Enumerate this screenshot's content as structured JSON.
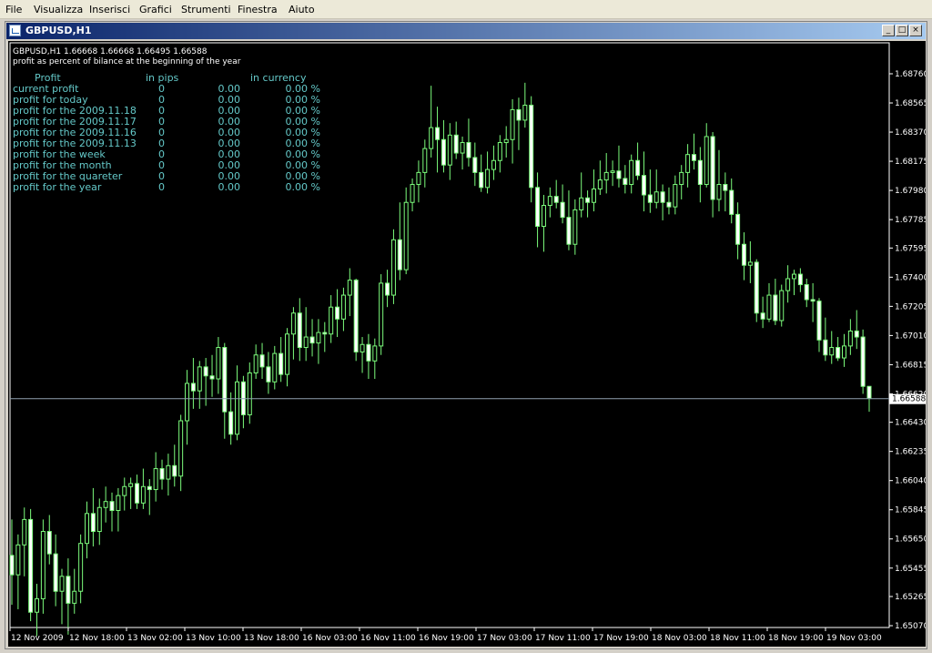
{
  "menu": [
    "File",
    "Visualizza",
    "Inserisci",
    "Grafici",
    "Strumenti",
    "Finestra",
    "Aiuto"
  ],
  "window": {
    "title": "GBPUSD,H1",
    "btn_min": "_",
    "btn_max": "□",
    "btn_close": "×"
  },
  "chart": {
    "header_line1": "GBPUSD,H1  1.66668 1.66668 1.66495 1.66588",
    "header_line2": "profit as percent of bilance at the beginning of the year",
    "profit_table": {
      "headers": [
        "Profit",
        "in pips",
        "in currency"
      ],
      "rows": [
        {
          "label": "current profit",
          "pips": "0",
          "currency": "0.00",
          "percent": "0.00 %"
        },
        {
          "label": "profit for today",
          "pips": "0",
          "currency": "0.00",
          "percent": "0.00 %"
        },
        {
          "label": "profit for the 2009.11.18",
          "pips": "0",
          "currency": "0.00",
          "percent": "0.00 %"
        },
        {
          "label": "profit for the 2009.11.17",
          "pips": "0",
          "currency": "0.00",
          "percent": "0.00 %"
        },
        {
          "label": "profit for the 2009.11.16",
          "pips": "0",
          "currency": "0.00",
          "percent": "0.00 %"
        },
        {
          "label": "profit for the 2009.11.13",
          "pips": "0",
          "currency": "0.00",
          "percent": "0.00 %"
        },
        {
          "label": "profit for the week",
          "pips": "0",
          "currency": "0.00",
          "percent": "0.00 %"
        },
        {
          "label": "profit for the month",
          "pips": "0",
          "currency": "0.00",
          "percent": "0.00 %"
        },
        {
          "label": "profit for the quareter",
          "pips": "0",
          "currency": "0.00",
          "percent": "0.00 %"
        },
        {
          "label": "profit for the year",
          "pips": "0",
          "currency": "0.00",
          "percent": "0.00 %"
        }
      ]
    },
    "current_price_label": "1.66588",
    "price_ticks": [
      "1.68760",
      "1.68565",
      "1.68370",
      "1.68175",
      "1.67980",
      "1.67785",
      "1.67595",
      "1.67400",
      "1.67205",
      "1.67010",
      "1.66815",
      "1.66620",
      "1.66430",
      "1.66235",
      "1.66040",
      "1.65845",
      "1.65650",
      "1.65455",
      "1.65265",
      "1.65070"
    ],
    "time_ticks": [
      "12 Nov 2009",
      "12 Nov 18:00",
      "13 Nov 02:00",
      "13 Nov 10:00",
      "13 Nov 18:00",
      "16 Nov 03:00",
      "16 Nov 11:00",
      "16 Nov 19:00",
      "17 Nov 03:00",
      "17 Nov 11:00",
      "17 Nov 19:00",
      "18 Nov 03:00",
      "18 Nov 11:00",
      "18 Nov 19:00",
      "19 Nov 03:00"
    ],
    "colors": {
      "background": "#000000",
      "candle": "#7cfc7c",
      "axis": "#ffffff",
      "profit_text": "#64c8c8",
      "price_line": "#8fa0b0"
    }
  },
  "chart_data": {
    "type": "candlestick",
    "symbol": "GBPUSD",
    "timeframe": "H1",
    "y_range": [
      1.6507,
      1.6876
    ],
    "current_price": 1.66588,
    "last_bar": {
      "open": 1.66668,
      "high": 1.66668,
      "low": 1.66495,
      "close": 1.66588
    },
    "candles": [
      [
        1.6554,
        1.6578,
        1.6521,
        1.6541
      ],
      [
        1.6541,
        1.6568,
        1.6518,
        1.6561
      ],
      [
        1.6561,
        1.6586,
        1.654,
        1.6578
      ],
      [
        1.6578,
        1.6585,
        1.651,
        1.6516
      ],
      [
        1.6516,
        1.6535,
        1.65,
        1.6525
      ],
      [
        1.6525,
        1.6578,
        1.6515,
        1.657
      ],
      [
        1.657,
        1.6581,
        1.6548,
        1.6555
      ],
      [
        1.6555,
        1.6568,
        1.652,
        1.653
      ],
      [
        1.653,
        1.6545,
        1.6508,
        1.654
      ],
      [
        1.654,
        1.6552,
        1.6501,
        1.6522
      ],
      [
        1.6522,
        1.6545,
        1.6515,
        1.653
      ],
      [
        1.653,
        1.6568,
        1.6522,
        1.6562
      ],
      [
        1.6562,
        1.659,
        1.6552,
        1.6582
      ],
      [
        1.6582,
        1.6599,
        1.656,
        1.657
      ],
      [
        1.657,
        1.6592,
        1.6561,
        1.6586
      ],
      [
        1.6586,
        1.66,
        1.6576,
        1.659
      ],
      [
        1.659,
        1.6596,
        1.657,
        1.6584
      ],
      [
        1.6584,
        1.6599,
        1.657,
        1.6594
      ],
      [
        1.6594,
        1.6606,
        1.6584,
        1.66
      ],
      [
        1.66,
        1.6606,
        1.6585,
        1.6602
      ],
      [
        1.6602,
        1.6608,
        1.6585,
        1.6589
      ],
      [
        1.6589,
        1.6612,
        1.6585,
        1.66
      ],
      [
        1.66,
        1.6605,
        1.6581,
        1.6598
      ],
      [
        1.6598,
        1.6623,
        1.659,
        1.6612
      ],
      [
        1.6612,
        1.6618,
        1.6598,
        1.6605
      ],
      [
        1.6605,
        1.6622,
        1.6594,
        1.6614
      ],
      [
        1.6614,
        1.6628,
        1.66,
        1.6607
      ],
      [
        1.6607,
        1.6648,
        1.6597,
        1.6644
      ],
      [
        1.6644,
        1.6678,
        1.6628,
        1.6669
      ],
      [
        1.6669,
        1.6686,
        1.6652,
        1.6664
      ],
      [
        1.6664,
        1.6684,
        1.6652,
        1.668
      ],
      [
        1.668,
        1.6686,
        1.6654,
        1.6674
      ],
      [
        1.6674,
        1.6688,
        1.666,
        1.6672
      ],
      [
        1.6672,
        1.67,
        1.6662,
        1.6693
      ],
      [
        1.6693,
        1.6696,
        1.6632,
        1.665
      ],
      [
        1.665,
        1.6663,
        1.6628,
        1.6635
      ],
      [
        1.6635,
        1.6681,
        1.6631,
        1.667
      ],
      [
        1.667,
        1.6674,
        1.6639,
        1.6648
      ],
      [
        1.6648,
        1.6683,
        1.6642,
        1.6676
      ],
      [
        1.6676,
        1.6695,
        1.6672,
        1.6688
      ],
      [
        1.6688,
        1.6696,
        1.6672,
        1.668
      ],
      [
        1.668,
        1.669,
        1.6662,
        1.667
      ],
      [
        1.667,
        1.6694,
        1.6665,
        1.6689
      ],
      [
        1.6689,
        1.67,
        1.667,
        1.6675
      ],
      [
        1.6675,
        1.6706,
        1.6667,
        1.6702
      ],
      [
        1.6702,
        1.672,
        1.6685,
        1.6716
      ],
      [
        1.6716,
        1.6726,
        1.6684,
        1.6693
      ],
      [
        1.6693,
        1.672,
        1.6684,
        1.67
      ],
      [
        1.67,
        1.6712,
        1.6687,
        1.6696
      ],
      [
        1.6696,
        1.6712,
        1.6682,
        1.6703
      ],
      [
        1.6703,
        1.671,
        1.669,
        1.6702
      ],
      [
        1.6702,
        1.6728,
        1.6696,
        1.672
      ],
      [
        1.672,
        1.6732,
        1.67,
        1.6712
      ],
      [
        1.6712,
        1.6733,
        1.6704,
        1.6728
      ],
      [
        1.6728,
        1.6746,
        1.6714,
        1.6738
      ],
      [
        1.6738,
        1.6739,
        1.6684,
        1.669
      ],
      [
        1.669,
        1.67,
        1.6676,
        1.6695
      ],
      [
        1.6695,
        1.6702,
        1.6672,
        1.6684
      ],
      [
        1.6684,
        1.6699,
        1.6672,
        1.6694
      ],
      [
        1.6694,
        1.6742,
        1.6688,
        1.6736
      ],
      [
        1.6736,
        1.6745,
        1.672,
        1.6728
      ],
      [
        1.6728,
        1.6772,
        1.6722,
        1.6765
      ],
      [
        1.6765,
        1.679,
        1.6738,
        1.6745
      ],
      [
        1.6745,
        1.68,
        1.6742,
        1.679
      ],
      [
        1.679,
        1.6806,
        1.6784,
        1.6802
      ],
      [
        1.6802,
        1.6818,
        1.679,
        1.681
      ],
      [
        1.681,
        1.6832,
        1.68,
        1.6826
      ],
      [
        1.6826,
        1.6868,
        1.682,
        1.684
      ],
      [
        1.684,
        1.6854,
        1.681,
        1.6832
      ],
      [
        1.6832,
        1.6845,
        1.681,
        1.6815
      ],
      [
        1.6815,
        1.6843,
        1.6805,
        1.6835
      ],
      [
        1.6835,
        1.6844,
        1.6819,
        1.6823
      ],
      [
        1.6823,
        1.6834,
        1.6812,
        1.683
      ],
      [
        1.683,
        1.6846,
        1.6814,
        1.682
      ],
      [
        1.682,
        1.683,
        1.6801,
        1.681
      ],
      [
        1.681,
        1.6822,
        1.6797,
        1.68
      ],
      [
        1.68,
        1.6824,
        1.6796,
        1.6812
      ],
      [
        1.6812,
        1.6828,
        1.6805,
        1.6818
      ],
      [
        1.6818,
        1.6835,
        1.681,
        1.683
      ],
      [
        1.683,
        1.6841,
        1.682,
        1.6832
      ],
      [
        1.6832,
        1.6859,
        1.6816,
        1.6852
      ],
      [
        1.6852,
        1.686,
        1.6825,
        1.6845
      ],
      [
        1.6845,
        1.687,
        1.684,
        1.6855
      ],
      [
        1.6855,
        1.6861,
        1.679,
        1.68
      ],
      [
        1.68,
        1.681,
        1.676,
        1.6774
      ],
      [
        1.6774,
        1.6795,
        1.6757,
        1.6788
      ],
      [
        1.6788,
        1.68,
        1.678,
        1.6794
      ],
      [
        1.6794,
        1.6805,
        1.6786,
        1.679
      ],
      [
        1.679,
        1.6802,
        1.6776,
        1.678
      ],
      [
        1.678,
        1.6798,
        1.6758,
        1.6762
      ],
      [
        1.6762,
        1.6792,
        1.6755,
        1.6785
      ],
      [
        1.6785,
        1.681,
        1.678,
        1.6793
      ],
      [
        1.6793,
        1.6798,
        1.678,
        1.679
      ],
      [
        1.679,
        1.6812,
        1.6784,
        1.6799
      ],
      [
        1.6799,
        1.6818,
        1.6795,
        1.6805
      ],
      [
        1.6805,
        1.6823,
        1.6796,
        1.681
      ],
      [
        1.681,
        1.6818,
        1.6801,
        1.6811
      ],
      [
        1.6811,
        1.6828,
        1.68,
        1.6806
      ],
      [
        1.6806,
        1.6815,
        1.6796,
        1.6802
      ],
      [
        1.6802,
        1.6822,
        1.6796,
        1.6818
      ],
      [
        1.6818,
        1.683,
        1.6805,
        1.6808
      ],
      [
        1.6808,
        1.6824,
        1.6784,
        1.6795
      ],
      [
        1.6795,
        1.6812,
        1.6783,
        1.679
      ],
      [
        1.679,
        1.6812,
        1.6786,
        1.6797
      ],
      [
        1.6797,
        1.6802,
        1.6778,
        1.679
      ],
      [
        1.679,
        1.68,
        1.6782,
        1.6787
      ],
      [
        1.6787,
        1.6808,
        1.6782,
        1.6802
      ],
      [
        1.6802,
        1.6815,
        1.6792,
        1.681
      ],
      [
        1.681,
        1.6829,
        1.68,
        1.6822
      ],
      [
        1.6822,
        1.6836,
        1.6812,
        1.6818
      ],
      [
        1.6818,
        1.6827,
        1.679,
        1.6802
      ],
      [
        1.6802,
        1.6843,
        1.68,
        1.6834
      ],
      [
        1.6834,
        1.6837,
        1.678,
        1.6792
      ],
      [
        1.6792,
        1.6825,
        1.6784,
        1.6802
      ],
      [
        1.6802,
        1.681,
        1.6784,
        1.6798
      ],
      [
        1.6798,
        1.6806,
        1.6776,
        1.6782
      ],
      [
        1.6782,
        1.679,
        1.6752,
        1.6762
      ],
      [
        1.6762,
        1.677,
        1.6738,
        1.6748
      ],
      [
        1.6748,
        1.6764,
        1.6736,
        1.675
      ],
      [
        1.675,
        1.6752,
        1.671,
        1.6716
      ],
      [
        1.6716,
        1.6727,
        1.6706,
        1.6712
      ],
      [
        1.6712,
        1.6736,
        1.671,
        1.6728
      ],
      [
        1.6728,
        1.6739,
        1.6708,
        1.6711
      ],
      [
        1.6711,
        1.6735,
        1.6707,
        1.6731
      ],
      [
        1.6731,
        1.6748,
        1.6723,
        1.6739
      ],
      [
        1.6739,
        1.6745,
        1.6728,
        1.6742
      ],
      [
        1.6742,
        1.6746,
        1.673,
        1.6735
      ],
      [
        1.6735,
        1.6739,
        1.672,
        1.6725
      ],
      [
        1.6725,
        1.6736,
        1.671,
        1.6724
      ],
      [
        1.6724,
        1.6726,
        1.669,
        1.6698
      ],
      [
        1.6698,
        1.6713,
        1.6684,
        1.6688
      ],
      [
        1.6688,
        1.6704,
        1.6682,
        1.6693
      ],
      [
        1.6693,
        1.67,
        1.6684,
        1.6686
      ],
      [
        1.6686,
        1.6702,
        1.668,
        1.6694
      ],
      [
        1.6694,
        1.6712,
        1.6688,
        1.6704
      ],
      [
        1.6704,
        1.6718,
        1.6692,
        1.67
      ],
      [
        1.67,
        1.6705,
        1.6662,
        1.6667
      ],
      [
        1.6667,
        1.6667,
        1.665,
        1.6659
      ]
    ]
  }
}
